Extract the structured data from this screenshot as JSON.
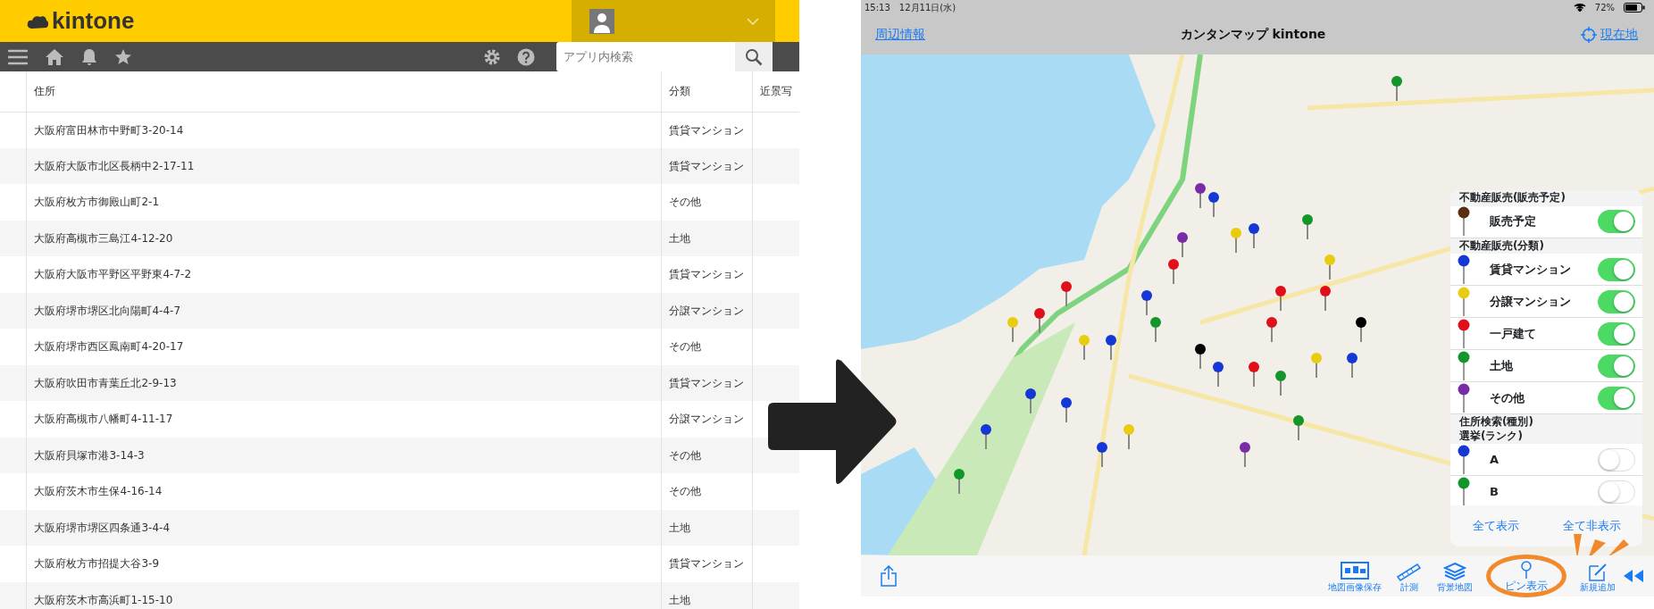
{
  "kintone": {
    "logo": "kintone",
    "search": {
      "placeholder": "アプリ内検索"
    },
    "table": {
      "columns": [
        "住所",
        "分類",
        "近景写"
      ],
      "rows": [
        [
          "大阪府富田林市中野町3-20-14",
          "賃貸マンション"
        ],
        [
          "大阪府大阪市北区長柄中2-17-11",
          "賃貸マンション"
        ],
        [
          "大阪府枚方市御殿山町2-1",
          "その他"
        ],
        [
          "大阪府高槻市三島江4-12-20",
          "土地"
        ],
        [
          "大阪府大阪市平野区平野東4-7-2",
          "賃貸マンション"
        ],
        [
          "大阪府堺市堺区北向陽町4-4-7",
          "分譲マンション"
        ],
        [
          "大阪府堺市西区鳳南町4-20-17",
          "その他"
        ],
        [
          "大阪府吹田市青葉丘北2-9-13",
          "賃貸マンション"
        ],
        [
          "大阪府高槻市八幡町4-11-17",
          "分譲マンション"
        ],
        [
          "大阪府貝塚市港3-14-3",
          "その他"
        ],
        [
          "大阪府茨木市生保4-16-14",
          "その他"
        ],
        [
          "大阪府堺市堺区四条通3-4-4",
          "土地"
        ],
        [
          "大阪府枚方市招提大谷3-9",
          "賃貸マンション"
        ],
        [
          "大阪府茨木市高浜町1-15-10",
          "土地"
        ]
      ]
    }
  },
  "app": {
    "status_bar": {
      "time": "15:13",
      "date": "12月11日(水)",
      "battery": "72%"
    },
    "nav": {
      "left": "周辺情報",
      "title": "カンタンマップ kintone",
      "right": "現在地"
    },
    "panel": {
      "sections": [
        {
          "title": "不動産販売(販売予定)",
          "items": [
            {
              "label": "販売予定",
              "color": "#5a2e0e",
              "on": true
            }
          ]
        },
        {
          "title": "不動産販売(分類)",
          "items": [
            {
              "label": "賃貸マンション",
              "color": "#1437d6",
              "on": true
            },
            {
              "label": "分譲マンション",
              "color": "#e8cc10",
              "on": true
            },
            {
              "label": "一戸建て",
              "color": "#e0101a",
              "on": true
            },
            {
              "label": "土地",
              "color": "#12962a",
              "on": true
            },
            {
              "label": "その他",
              "color": "#7a2ca8",
              "on": true
            }
          ]
        },
        {
          "title": "住所検索(種別)\n選挙(ランク)",
          "items": [
            {
              "label": "A",
              "color": "#1437d6",
              "on": false
            },
            {
              "label": "B",
              "color": "#12962a",
              "on": false
            }
          ]
        }
      ],
      "buttons": [
        "全て表示",
        "全て非表示"
      ]
    },
    "toolbar": [
      {
        "kind": "map",
        "label": "地図画像保存",
        "selected": false
      },
      {
        "kind": "ruler",
        "label": "計測",
        "selected": false
      },
      {
        "kind": "layers",
        "label": "背景地図",
        "selected": false
      },
      {
        "kind": "pin",
        "label": "ピン表示",
        "selected": true
      },
      {
        "kind": "edit",
        "label": "新規追加",
        "selected": false
      }
    ]
  }
}
